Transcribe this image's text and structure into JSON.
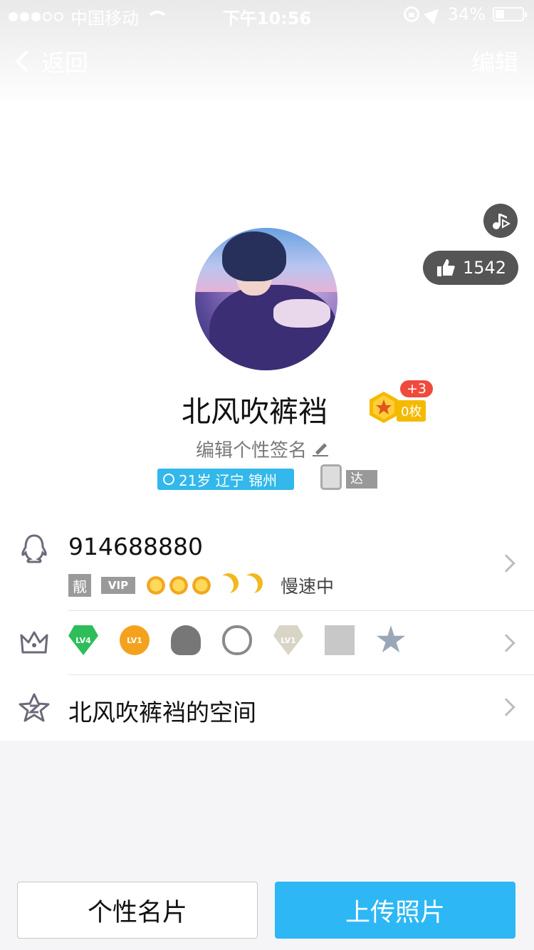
{
  "status_bar": {
    "carrier": "中国移动",
    "time": "下午10:56",
    "battery": "34%",
    "signal_bars_filled": 3,
    "signal_bars_total": 5
  },
  "nav": {
    "back_label": "返回",
    "edit_label": "编辑"
  },
  "profile": {
    "likes": "1542",
    "name": "北风吹裤裆",
    "medal_badge": "+3",
    "medal_count": "0枚",
    "signature": "编辑个性签名",
    "info_tag": "21岁 辽宁 锦州",
    "expert_tag": "达人"
  },
  "qq_row": {
    "number": "914688880",
    "liang": "靓",
    "vip": "VIP",
    "speed": "慢速中",
    "level_icons": [
      "sun-icon",
      "sun-icon",
      "sun-icon",
      "moon-icon",
      "moon-icon"
    ]
  },
  "badges_row": {
    "badges": [
      {
        "name": "svip-lv4-badge",
        "label": "LV4"
      },
      {
        "name": "music-lv1-badge",
        "label": "LV1"
      },
      {
        "name": "penguin-badge",
        "label": ""
      },
      {
        "name": "cloud-badge",
        "label": ""
      },
      {
        "name": "diamond-lv1-badge",
        "label": "LV1"
      },
      {
        "name": "book-badge",
        "label": ""
      },
      {
        "name": "star-badge",
        "label": ""
      }
    ]
  },
  "space_row": {
    "label": "北风吹裤裆的空间"
  },
  "buttons": {
    "left": "个性名片",
    "right": "上传照片"
  },
  "colors": {
    "accent": "#2db7f5",
    "tag_blue": "#32b8ea",
    "medal": "#f5b900",
    "badge_red": "#f04a3c"
  }
}
